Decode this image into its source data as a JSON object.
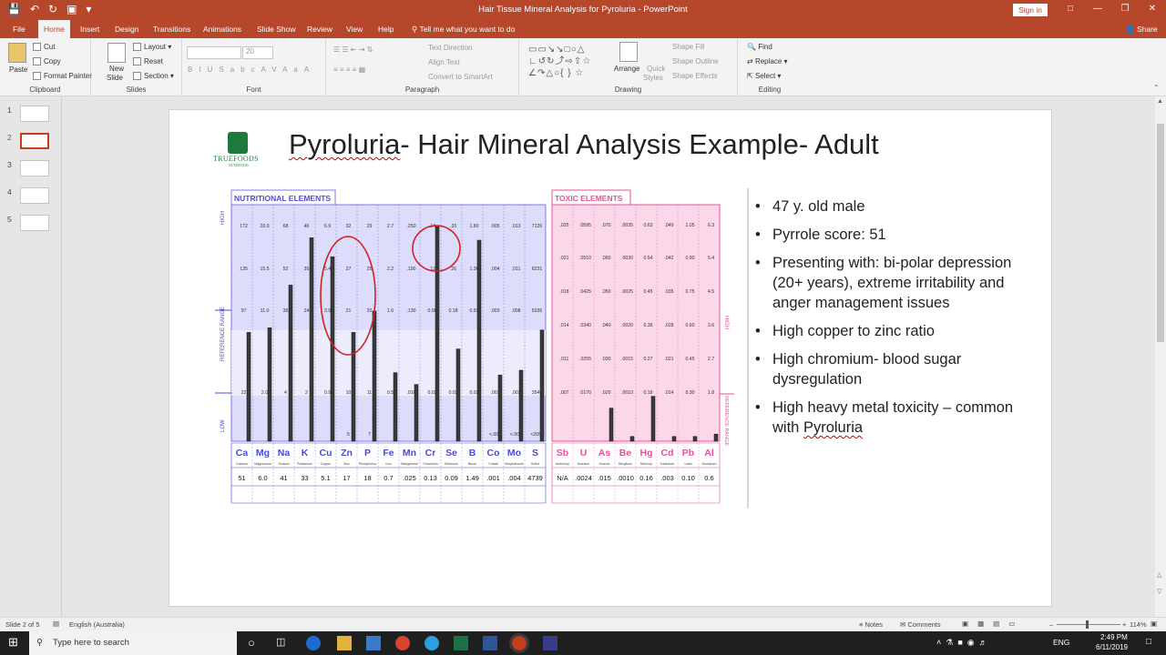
{
  "window": {
    "title": "Hair Tissue Mineral Analysis for Pyroluria  -  PowerPoint",
    "signin": "Sign in"
  },
  "tabs": [
    "File",
    "Home",
    "Insert",
    "Design",
    "Transitions",
    "Animations",
    "Slide Show",
    "Review",
    "View",
    "Help"
  ],
  "tell_me": "Tell me what you want to do",
  "share": "Share",
  "ribbon": {
    "clipboard": {
      "paste": "Paste",
      "cut": "Cut",
      "copy": "Copy",
      "format_painter": "Format Painter",
      "label": "Clipboard"
    },
    "slides": {
      "new_slide": "New",
      "new_slide2": "Slide",
      "layout": "Layout",
      "reset": "Reset",
      "section": "Section",
      "label": "Slides"
    },
    "font": {
      "size": "20",
      "label": "Font",
      "buttons": [
        "B",
        "I",
        "U",
        "S",
        "abc",
        "AV",
        "Aa",
        "A"
      ]
    },
    "paragraph": {
      "text_direction": "Text Direction",
      "align_text": "Align Text",
      "smartart": "Convert to SmartArt",
      "label": "Paragraph"
    },
    "drawing": {
      "arrange": "Arrange",
      "quick_styles": "Quick",
      "quick_styles2": "Styles",
      "shape_fill": "Shape Fill",
      "shape_outline": "Shape Outline",
      "shape_effects": "Shape Effects",
      "label": "Drawing"
    },
    "editing": {
      "find": "Find",
      "replace": "Replace",
      "select": "Select",
      "label": "Editing"
    }
  },
  "thumbnails": [
    "1",
    "2",
    "3",
    "4",
    "5"
  ],
  "slide": {
    "logo_top": "TRUEFOODS",
    "logo_bottom": "NUTRITION",
    "title_part1": "Pyroluria",
    "title_part2": "- Hair Mineral Analysis Example- Adult",
    "bullets": [
      "47 y. old male",
      "Pyrrole score: 51",
      "Presenting with: bi-polar depression (20+ years), extreme irritability and anger management issues",
      "High copper to zinc ratio",
      "High chromium- blood sugar dysregulation"
    ],
    "bullet_last_a": "High heavy metal toxicity – common with ",
    "bullet_last_b": "Pyroluria"
  },
  "chart_data": {
    "type": "bar",
    "title": "",
    "nutritional_header": "NUTRITIONAL ELEMENTS",
    "toxic_header": "TOXIC ELEMENTS",
    "axis_left": {
      "high": "HIGH",
      "reference": "REFERENCE RANGE",
      "low": "LOW"
    },
    "axis_right": {
      "high": "HIGH",
      "reference": "REFERENCE RANGE"
    },
    "nutritional": {
      "symbols": [
        "Ca",
        "Mg",
        "Na",
        "K",
        "Cu",
        "Zn",
        "P",
        "Fe",
        "Mn",
        "Cr",
        "Se",
        "B",
        "Co",
        "Mo",
        "S"
      ],
      "names": [
        "Calcium",
        "Magnesium",
        "Sodium",
        "Potassium",
        "Copper",
        "Zinc",
        "Phosphorus",
        "Iron",
        "Manganese",
        "Chromium",
        "Selenium",
        "Boron",
        "Cobalt",
        "Molybdenum",
        "Sulfur"
      ],
      "values": [
        "51",
        "6.0",
        "41",
        "33",
        "5.1",
        "17",
        "18",
        "0.7",
        ".025",
        "0.13",
        "0.09",
        "1.49",
        ".001",
        ".004",
        "4739"
      ],
      "bar_levels": [
        0.46,
        0.48,
        0.66,
        0.86,
        0.78,
        0.46,
        0.55,
        0.29,
        0.24,
        0.91,
        0.39,
        0.85,
        0.28,
        0.3,
        0.47
      ],
      "scale_rows": [
        [
          "172",
          "20.0",
          "68",
          "46",
          "6.9",
          "32",
          "29",
          "2.7",
          ".250",
          ".14",
          ".33",
          "1.80",
          ".005",
          ".013",
          "7126"
        ],
        [
          "135",
          "15.5",
          "52",
          "35",
          "5.4",
          "27",
          "25",
          "2.2",
          ".190",
          ".12",
          ".26",
          "1.36",
          ".004",
          ".011",
          "6231"
        ],
        [
          "97",
          "11.0",
          "36",
          "24",
          "3.9",
          "21",
          "20",
          "1.6",
          ".130",
          "0.08",
          "0.18",
          "0.91",
          ".003",
          ".008",
          "5336"
        ],
        [
          "22",
          "2.0",
          "4",
          "2",
          "0.9",
          "10",
          "11",
          "0.5",
          ".010",
          "0.02",
          "0.03",
          "0.02",
          ".001",
          ".003",
          "3546"
        ],
        [
          "",
          "",
          "",
          "",
          "",
          "5",
          "7",
          "",
          "",
          "",
          "",
          "",
          "<.000",
          "<.001",
          "<2651"
        ]
      ]
    },
    "toxic": {
      "symbols": [
        "Sb",
        "U",
        "As",
        "Be",
        "Hg",
        "Cd",
        "Pb",
        "Al"
      ],
      "names": [
        "Antimony",
        "Uranium",
        "Arsenic",
        "Beryllium",
        "Mercury",
        "Cadmium",
        "Lead",
        "Aluminum"
      ],
      "values": [
        "N/A",
        ".0024",
        ".015",
        ".0010",
        "0.16",
        ".003",
        "0.10",
        "0.6"
      ],
      "bar_levels": [
        0,
        0,
        0.14,
        0.02,
        0.19,
        0.02,
        0.02,
        0.03
      ],
      "scale_rows": [
        [
          ".025",
          ".0595",
          ".070",
          ".0035",
          "0.63",
          ".049",
          "1.05",
          "6.3"
        ],
        [
          ".021",
          ".0510",
          ".060",
          ".0030",
          "0.54",
          ".042",
          "0.90",
          "5.4"
        ],
        [
          ".018",
          ".0425",
          ".050",
          ".0025",
          "0.45",
          ".035",
          "0.75",
          "4.5"
        ],
        [
          ".014",
          ".0340",
          ".040",
          ".0020",
          "0.36",
          ".028",
          "0.60",
          "3.6"
        ],
        [
          ".011",
          ".0255",
          ".030",
          ".0015",
          "0.27",
          ".021",
          "0.45",
          "2.7"
        ],
        [
          ".007",
          ".0170",
          ".020",
          ".0010",
          "0.18",
          ".014",
          "0.30",
          "1.8"
        ]
      ]
    }
  },
  "status": {
    "slide": "Slide 2 of 5",
    "lang": "English (Australia)",
    "notes": "Notes",
    "comments": "Comments",
    "zoom": "114%"
  },
  "taskbar": {
    "search": "Type here to search",
    "lang": "ENG",
    "time": "2:49 PM",
    "date": "6/11/2019"
  },
  "colors": {
    "accent": "#b7472a",
    "nutri": "#4b4bd8",
    "toxic": "#ea4f9d"
  }
}
